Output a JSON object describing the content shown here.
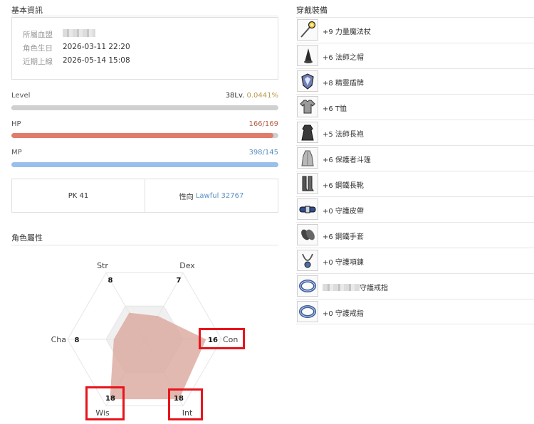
{
  "basic_info": {
    "title": "基本資訊",
    "clan_label": "所屬血盟",
    "birth_label": "角色生日",
    "birth_value": "2026-03-11 22:20",
    "last_login_label": "近期上線",
    "last_login_value": "2026-05-14 15:08"
  },
  "bars": {
    "level": {
      "label": "Level",
      "value": "38Lv.",
      "percent_text": "0.0441%",
      "fill_fraction": 0.0004,
      "color": "#c8c8c8"
    },
    "hp": {
      "label": "HP",
      "value": "166/169",
      "fill_fraction": 0.98,
      "color": "#e07d6a"
    },
    "mp": {
      "label": "MP",
      "value": "398/145",
      "fill_fraction": 1.0,
      "color": "#98c0ea"
    }
  },
  "stats": {
    "pk_text": "PK 41",
    "alignment_label": "性向",
    "alignment_value": "Lawful 32767"
  },
  "attributes": {
    "title": "角色屬性",
    "items": [
      {
        "name": "Str",
        "value": "8"
      },
      {
        "name": "Dex",
        "value": "7"
      },
      {
        "name": "Con",
        "value": "16"
      },
      {
        "name": "Int",
        "value": "18"
      },
      {
        "name": "Wis",
        "value": "18"
      },
      {
        "name": "Cha",
        "value": "8"
      }
    ]
  },
  "equipment": {
    "title": "穿戴裝備",
    "items": [
      {
        "label": "+9 力量魔法杖",
        "icon": "staff-icon"
      },
      {
        "label": "+6 法師之帽",
        "icon": "wizard-hat-icon"
      },
      {
        "label": "+8 精靈盾牌",
        "icon": "shield-icon"
      },
      {
        "label": "+6 T恤",
        "icon": "tshirt-icon"
      },
      {
        "label": "+5 法師長袍",
        "icon": "robe-icon"
      },
      {
        "label": "+6 保護者斗篷",
        "icon": "cloak-icon"
      },
      {
        "label": "+6 鋼鐵長靴",
        "icon": "boots-icon"
      },
      {
        "label": "+0 守護皮帶",
        "icon": "belt-icon"
      },
      {
        "label": "+6 鋼鐵手套",
        "icon": "gloves-icon"
      },
      {
        "label": "+0 守護項鍊",
        "icon": "necklace-icon"
      },
      {
        "label": "守護戒指",
        "icon": "ring-icon"
      },
      {
        "label": "+0 守護戒指",
        "icon": "ring-icon"
      }
    ]
  },
  "colors": {
    "hp": "#e07d6a",
    "mp": "#98c0ea",
    "level_percent": "#b89a4f",
    "alignment": "#5a8fbf",
    "highlight": "#e8141c",
    "radar_fill": "#dba79c"
  }
}
